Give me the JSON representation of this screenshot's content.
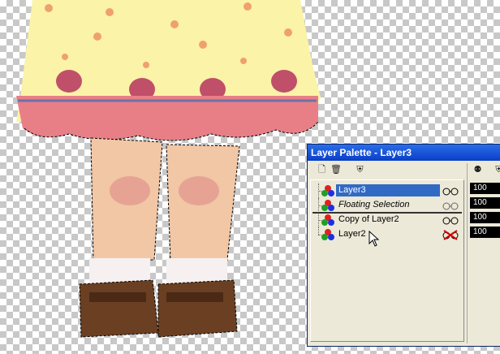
{
  "palette": {
    "title": "Layer Palette - Layer3",
    "toolbar_icons": [
      "new-layer-icon",
      "delete-layer-icon",
      "layer-mask-icon"
    ],
    "header_icons": [
      "blend-mode-icon",
      "lock-icon"
    ],
    "layers": [
      {
        "name": "Layer3",
        "selected": true,
        "italic": false,
        "visible": true,
        "opacity": "100"
      },
      {
        "name": "Floating Selection",
        "selected": false,
        "italic": true,
        "visible": true,
        "opacity": "100"
      },
      {
        "name": "Copy of Layer2",
        "selected": false,
        "italic": false,
        "visible": true,
        "opacity": "100"
      },
      {
        "name": "Layer2",
        "selected": false,
        "italic": false,
        "visible": false,
        "opacity": "100"
      }
    ]
  },
  "colors": {
    "dress": "#fbf3a8",
    "hem": "#e87f86",
    "skin": "#f1c7a6",
    "shoe": "#6b3f22",
    "titlebar": "#0a3ec8",
    "selection": "#316ac5"
  }
}
